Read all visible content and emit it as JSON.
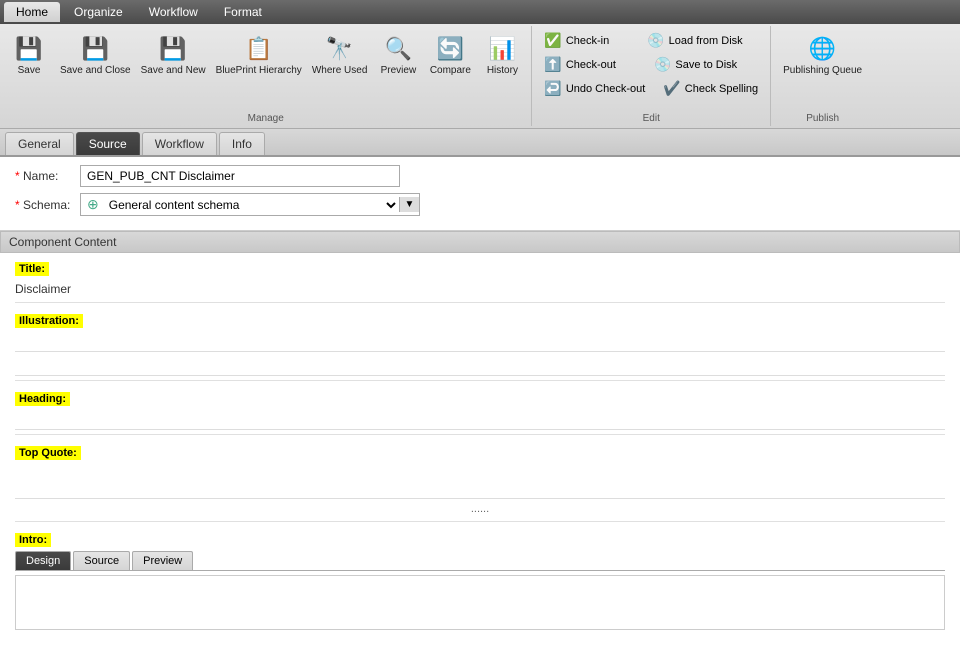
{
  "nav": {
    "tabs": [
      {
        "label": "Home",
        "active": true
      },
      {
        "label": "Organize",
        "active": false
      },
      {
        "label": "Workflow",
        "active": false
      },
      {
        "label": "Format",
        "active": false
      }
    ]
  },
  "ribbon": {
    "groups": {
      "manage": {
        "label": "Manage",
        "buttons": [
          {
            "id": "save",
            "label": "Save",
            "icon": "💾"
          },
          {
            "id": "save-close",
            "label": "Save and Close",
            "icon": "💾"
          },
          {
            "id": "save-new",
            "label": "Save and New",
            "icon": "💾"
          },
          {
            "id": "blueprint",
            "label": "BluePrint Hierarchy",
            "icon": "📋"
          },
          {
            "id": "whereused",
            "label": "Where Used",
            "icon": "🔭"
          },
          {
            "id": "preview",
            "label": "Preview",
            "icon": "🔍"
          },
          {
            "id": "compare",
            "label": "Compare",
            "icon": "🔄"
          },
          {
            "id": "history",
            "label": "History",
            "icon": "📊"
          }
        ]
      },
      "edit": {
        "label": "Edit",
        "buttons_row1": [
          {
            "id": "checkin",
            "label": "Check-in",
            "icon": "✅"
          },
          {
            "id": "load-disk",
            "label": "Load from Disk",
            "icon": "💿"
          }
        ],
        "buttons_row2": [
          {
            "id": "checkout",
            "label": "Check-out",
            "icon": "⬆️"
          },
          {
            "id": "save-disk",
            "label": "Save to Disk",
            "icon": "💿"
          }
        ],
        "buttons_row3": [
          {
            "id": "undo-checkout",
            "label": "Undo Check-out",
            "icon": "↩️"
          },
          {
            "id": "spell-check",
            "label": "Check Spelling",
            "icon": "✔️"
          }
        ]
      },
      "publish": {
        "label": "Publish",
        "buttons": [
          {
            "id": "publishing-queue",
            "label": "Publishing Queue",
            "icon": "🌐"
          }
        ]
      }
    }
  },
  "content_tabs": [
    {
      "label": "General",
      "active": false
    },
    {
      "label": "Source",
      "active": true
    },
    {
      "label": "Workflow",
      "active": false
    },
    {
      "label": "Info",
      "active": false
    }
  ],
  "form": {
    "name_label": "Name:",
    "name_required": "*",
    "name_value": "GEN_PUB_CNT Disclaimer",
    "schema_label": "Schema:",
    "schema_required": "*",
    "schema_value": "General content schema"
  },
  "component": {
    "section_title": "Component Content",
    "fields": [
      {
        "id": "title",
        "label": "Title:",
        "value": "Disclaimer",
        "type": "text"
      },
      {
        "id": "illustration",
        "label": "Illustration:",
        "value": "",
        "type": "input-lines"
      },
      {
        "id": "heading",
        "label": "Heading:",
        "value": "",
        "type": "input-line"
      },
      {
        "id": "top-quote",
        "label": "Top Quote:",
        "value": "",
        "type": "textarea-small"
      },
      {
        "id": "intro",
        "label": "Intro:",
        "value": "",
        "type": "editor"
      }
    ],
    "ellipsis": "......",
    "inner_tabs": [
      {
        "label": "Design",
        "active": true
      },
      {
        "label": "Source",
        "active": false
      },
      {
        "label": "Preview",
        "active": false
      }
    ]
  }
}
